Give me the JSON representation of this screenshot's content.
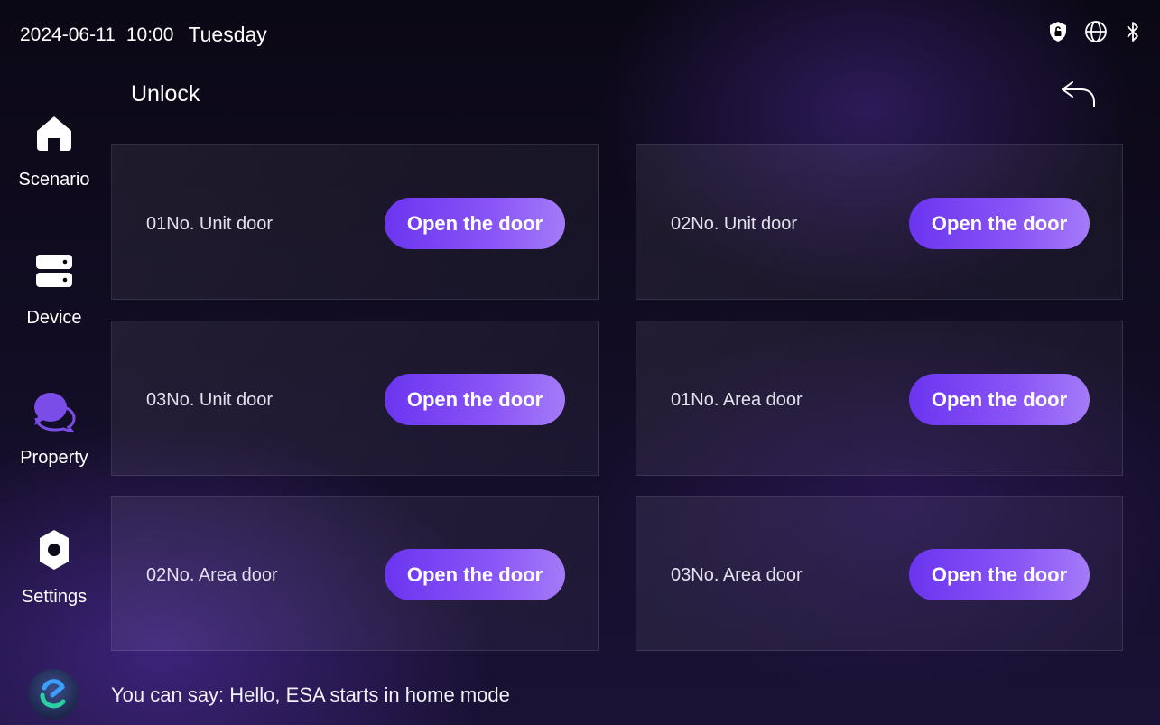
{
  "status": {
    "date": "2024-06-11",
    "time": "10:00",
    "weekday": "Tuesday",
    "icons": [
      "security-shield-icon",
      "globe-icon",
      "bluetooth-icon"
    ]
  },
  "sidebar": {
    "items": [
      {
        "label": "Scenario",
        "icon": "home-icon"
      },
      {
        "label": "Device",
        "icon": "server-icon"
      },
      {
        "label": "Property",
        "icon": "chat-bubbles-icon",
        "icon_color": "#7b4de8"
      },
      {
        "label": "Settings",
        "icon": "gear-icon"
      }
    ]
  },
  "page": {
    "title": "Unlock",
    "back_icon": "back-arrow-icon"
  },
  "doors": [
    {
      "name": "01No. Unit door",
      "action": "Open the door"
    },
    {
      "name": "02No. Unit door",
      "action": "Open the door"
    },
    {
      "name": "03No. Unit door",
      "action": "Open the door"
    },
    {
      "name": "01No. Area door",
      "action": "Open the door"
    },
    {
      "name": "02No. Area door",
      "action": "Open the door"
    },
    {
      "name": "03No. Area door",
      "action": "Open the door"
    }
  ],
  "assistant": {
    "hint": "You can say: Hello, ESA starts in home mode",
    "logo_icon": "assistant-logo-icon"
  },
  "colors": {
    "accent": "#7c46f3",
    "background": "#120d24"
  }
}
